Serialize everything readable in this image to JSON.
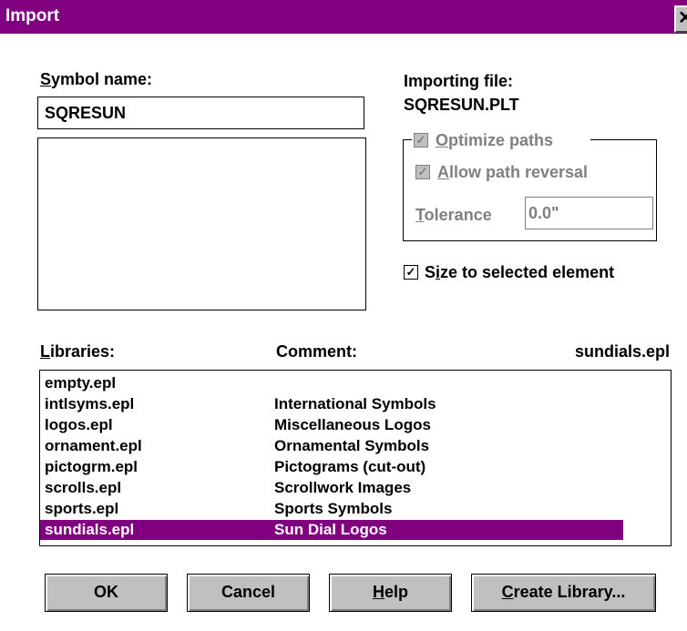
{
  "window": {
    "title": "Import",
    "close_glyph": "✕"
  },
  "symbol": {
    "label": "Symbol name:",
    "label_accel": "S",
    "label_rest": "ymbol name:",
    "value": "SQRESUN"
  },
  "importing": {
    "label": "Importing file:",
    "file": "SQRESUN.PLT"
  },
  "optimize": {
    "label_accel": "O",
    "label_rest": "ptimize paths",
    "checked": true,
    "enabled": false,
    "allow_reversal": {
      "label_accel": "A",
      "label_rest": "llow path reversal",
      "checked": true,
      "enabled": false
    },
    "tolerance": {
      "label_accel": "T",
      "label_rest": "olerance",
      "value": "0.0\""
    }
  },
  "size_to_selected": {
    "label_pre": "S",
    "label_accel": "i",
    "label_rest": "ze to selected element",
    "checked": true
  },
  "libraries": {
    "label_accel": "L",
    "label_rest": "ibraries:",
    "comment_label": "Comment:",
    "selected_name": "sundials.epl",
    "rows": [
      {
        "name": "empty.epl",
        "comment": ""
      },
      {
        "name": "intlsyms.epl",
        "comment": "International Symbols"
      },
      {
        "name": "logos.epl",
        "comment": "Miscellaneous Logos"
      },
      {
        "name": "ornament.epl",
        "comment": "Ornamental Symbols"
      },
      {
        "name": "pictogrm.epl",
        "comment": "Pictograms (cut-out)"
      },
      {
        "name": "scrolls.epl",
        "comment": "Scrollwork Images"
      },
      {
        "name": "sports.epl",
        "comment": "Sports Symbols"
      },
      {
        "name": "sundials.epl",
        "comment": "Sun Dial Logos"
      }
    ],
    "selected_index": 7,
    "scroll_up_glyph": "▲",
    "scroll_down_glyph": "▼"
  },
  "buttons": {
    "ok": "OK",
    "cancel": "Cancel",
    "help_accel": "H",
    "help_rest": "elp",
    "create_accel": "C",
    "create_rest": "reate Library..."
  },
  "check_glyph": "✓",
  "colors": {
    "title_bar": "#800080",
    "selection": "#800080",
    "face": "#c0c0c0"
  }
}
